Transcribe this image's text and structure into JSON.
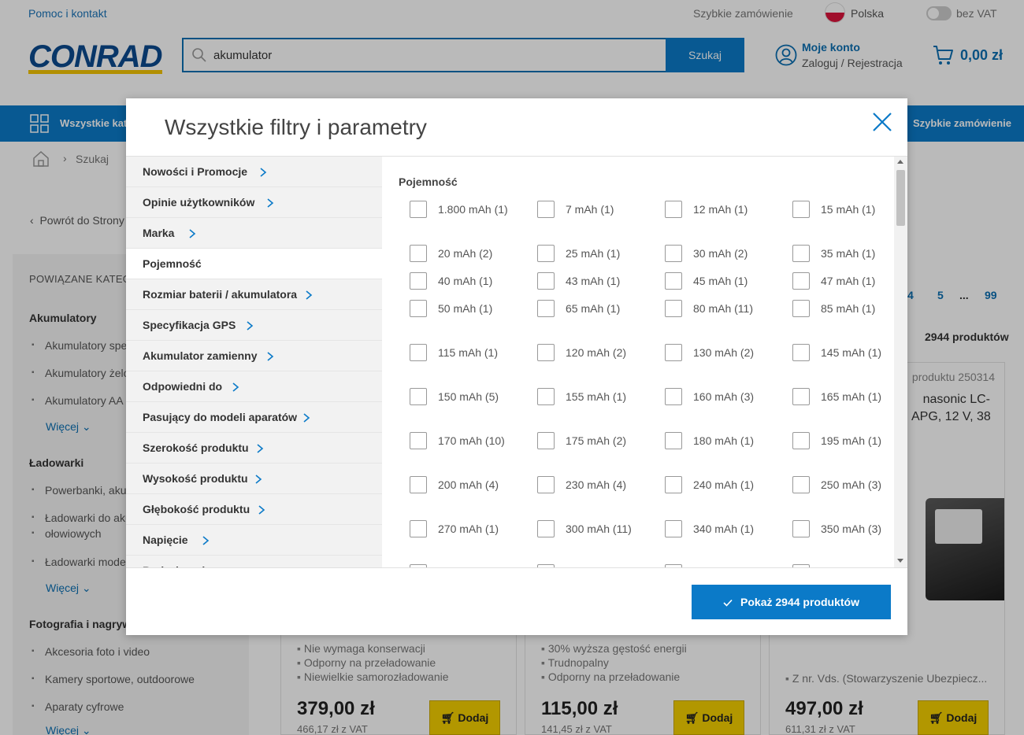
{
  "topbar": {
    "help": "Pomoc i kontakt",
    "quick_order": "Szybkie zamówienie",
    "country": "Polska",
    "vat": "bez VAT"
  },
  "header": {
    "logo": "CONRAD",
    "search_value": "akumulator",
    "search_button": "Szukaj",
    "account_title": "Moje konto",
    "account_sub": "Zaloguj / Rejestracja",
    "cart_amount": "0,00 zł"
  },
  "navbar": {
    "all_categories": "Wszystkie kategorie",
    "quick_order": "Szybkie zamówienie"
  },
  "breadcrumb": {
    "label": "Szukaj"
  },
  "back_link": "Powrót do Strony",
  "sidebar": {
    "header": "POWIĄZANE KATEGORIE",
    "sections": [
      {
        "title": "Akumulatory",
        "items": [
          "Akumulatory specjalne",
          "Akumulatory żelowe",
          "Akumulatory AA"
        ],
        "more": "Więcej"
      },
      {
        "title": "Ładowarki",
        "items": [
          "Powerbanki, akumulatory",
          "Ładowarki do akumulatorów",
          "ołowiowych",
          "Ładowarki modelarskie"
        ],
        "more": "Więcej"
      },
      {
        "title": "Fotografia i nagrywanie",
        "items": [
          "Akcesoria foto i video",
          "Kamery sportowe, outdoorowe",
          "Aparaty cyfrowe"
        ],
        "more": "Więcej"
      }
    ]
  },
  "pager": {
    "p4": "4",
    "p5": "5",
    "dots": "...",
    "last": "99"
  },
  "product_count": "2944 produktów",
  "cards": [
    {
      "features": [
        "Nie wymaga konserwacji",
        "Odporny na przeładowanie",
        "Niewielkie samorozładowanie"
      ],
      "price": "379,00 zł",
      "net": "466,17 zł z VAT",
      "add": "Dodaj"
    },
    {
      "features": [
        "30% wyższa gęstość energii",
        "Trudnopalny",
        "Odporny na przeładowanie"
      ],
      "price": "115,00 zł",
      "net": "141,45 zł z VAT",
      "add": "Dodaj"
    },
    {
      "number": "produktu 250314",
      "title1": "nasonic LC-",
      "title2": "APG, 12 V, 38",
      "features": [
        "Z nr. Vds. (Stowarzyszenie Ubezpiecz..."
      ],
      "price": "497,00 zł",
      "net": "611,31 zł z VAT",
      "add": "Dodaj"
    }
  ],
  "modal": {
    "title": "Wszystkie filtry i parametry",
    "categories": [
      {
        "label": "Nowości i Promocje",
        "active": false
      },
      {
        "label": "Opinie użytkowników",
        "active": false
      },
      {
        "label": "Marka",
        "active": false
      },
      {
        "label": "Pojemność",
        "active": true
      },
      {
        "label": "Rozmiar baterii / akumulatora",
        "active": false
      },
      {
        "label": "Specyfikacja GPS",
        "active": false
      },
      {
        "label": "Akumulator zamienny",
        "active": false
      },
      {
        "label": "Odpowiedni do",
        "active": false
      },
      {
        "label": "Pasujący do modeli aparatów",
        "active": false
      },
      {
        "label": "Szerokość produktu",
        "active": false
      },
      {
        "label": "Wysokość produktu",
        "active": false
      },
      {
        "label": "Głębokość produktu",
        "active": false
      },
      {
        "label": "Napięcie",
        "active": false
      },
      {
        "label": "Rodzaj ogniw",
        "active": false
      }
    ],
    "panel_title": "Pojemność",
    "options": [
      "1.800 mAh (1)",
      "7 mAh (1)",
      "12 mAh (1)",
      "15 mAh (1)",
      "20 mAh (2)",
      "25 mAh (1)",
      "30 mAh (2)",
      "35 mAh (1)",
      "40 mAh (1)",
      "43 mAh (1)",
      "45 mAh (1)",
      "47 mAh (1)",
      "50 mAh (1)",
      "65 mAh (1)",
      "80 mAh (11)",
      "85 mAh (1)",
      "115 mAh (1)",
      "120 mAh (2)",
      "130 mAh (2)",
      "145 mAh (1)",
      "150 mAh (5)",
      "155 mAh (1)",
      "160 mAh (3)",
      "165 mAh (1)",
      "170 mAh (10)",
      "175 mAh (2)",
      "180 mAh (1)",
      "195 mAh (1)",
      "200 mAh (4)",
      "230 mAh (4)",
      "240 mAh (1)",
      "250 mAh (3)",
      "270 mAh (1)",
      "300 mAh (11)",
      "340 mAh (1)",
      "350 mAh (3)",
      "",
      "",
      "",
      ""
    ],
    "show_button": "Pokaż 2944 produktów"
  },
  "colors": {
    "brand_blue": "#0b7ac8",
    "add_yellow": "#f5d000",
    "logo_yellow": "#f5c400"
  }
}
